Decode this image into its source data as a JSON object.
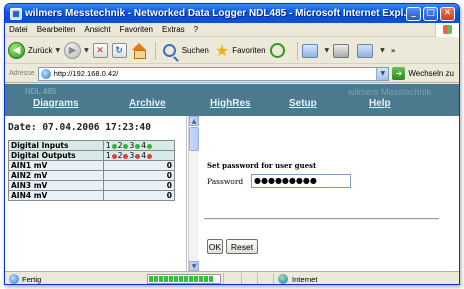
{
  "window": {
    "title": "wilmers Messtechnik - Networked Data Logger NDL485 - Microsoft Internet Expl...",
    "controls": {
      "minimize": "_",
      "maximize": "□",
      "close": "✕"
    }
  },
  "menubar": {
    "items": [
      {
        "label": "Datei"
      },
      {
        "label": "Bearbeiten"
      },
      {
        "label": "Ansicht"
      },
      {
        "label": "Favoriten"
      },
      {
        "label": "Extras"
      },
      {
        "label": "?"
      }
    ]
  },
  "toolbar": {
    "back_label": "Zurück",
    "search_label": "Suchen",
    "favorites_label": "Favoriten",
    "more_glyph": "»"
  },
  "addressbar": {
    "label": "Adresse",
    "url": "http://192.168.0.42/",
    "go_label": "Wechseln zu"
  },
  "app": {
    "brand_left": "NDL 485",
    "brand_right": "wilmers Messtechnik",
    "nav": {
      "diagrams": "Diagrams",
      "archive": "Archive",
      "highres": "HighRes",
      "setup": "Setup",
      "help": "Help"
    },
    "date_label": "Date: 07.04.2006 17:23:40",
    "digital_inputs": {
      "label": "Digital Inputs",
      "channels": [
        {
          "num": "1",
          "state": "green"
        },
        {
          "num": "2",
          "state": "green"
        },
        {
          "num": "3",
          "state": "green"
        },
        {
          "num": "4",
          "state": "green"
        }
      ]
    },
    "digital_outputs": {
      "label": "Digital Outputs",
      "channels": [
        {
          "num": "1",
          "state": "red"
        },
        {
          "num": "2",
          "state": "red"
        },
        {
          "num": "3",
          "state": "red"
        },
        {
          "num": "4",
          "state": "red"
        }
      ]
    },
    "analog": [
      {
        "label": "AIN1 mV",
        "value": "0"
      },
      {
        "label": "AIN2 mV",
        "value": "0"
      },
      {
        "label": "AIN3 mV",
        "value": "0"
      },
      {
        "label": "AIN4 mV",
        "value": "0"
      }
    ],
    "password_form": {
      "title": "Set password for user guest",
      "label": "Password",
      "value": "●●●●●●●●●",
      "ok_label": "OK",
      "reset_label": "Reset"
    }
  },
  "statusbar": {
    "text": "Fertig",
    "zone": "Internet"
  },
  "colors": {
    "header_bg": "#4b7a8f",
    "led_green": "#37b03a",
    "led_red": "#e0403a",
    "progress": "#33c23a"
  }
}
